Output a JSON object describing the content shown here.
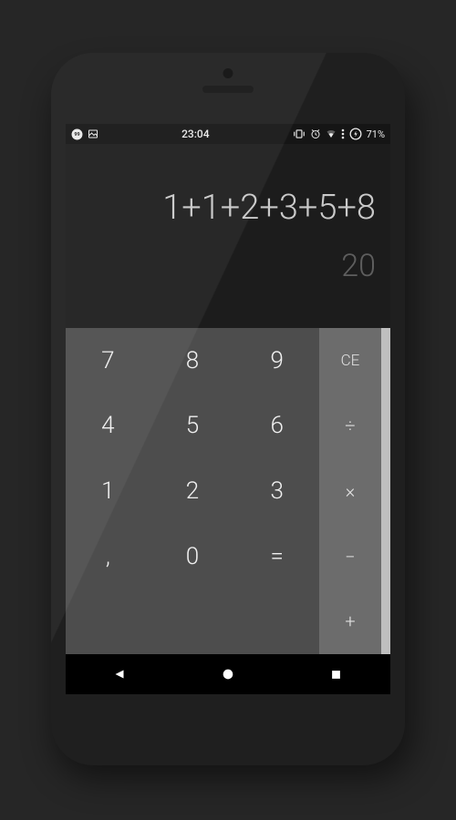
{
  "statusbar": {
    "time": "23:04",
    "battery": "71%"
  },
  "display": {
    "expression": "1+1+2+3+5+8",
    "result": "20"
  },
  "keys": {
    "k7": "7",
    "k8": "8",
    "k9": "9",
    "k4": "4",
    "k5": "5",
    "k6": "6",
    "k1": "1",
    "k2": "2",
    "k3": "3",
    "comma": ",",
    "k0": "0",
    "eq": "="
  },
  "ops": {
    "ce": "CE",
    "div": "÷",
    "mul": "×",
    "sub": "−",
    "add": "+"
  }
}
